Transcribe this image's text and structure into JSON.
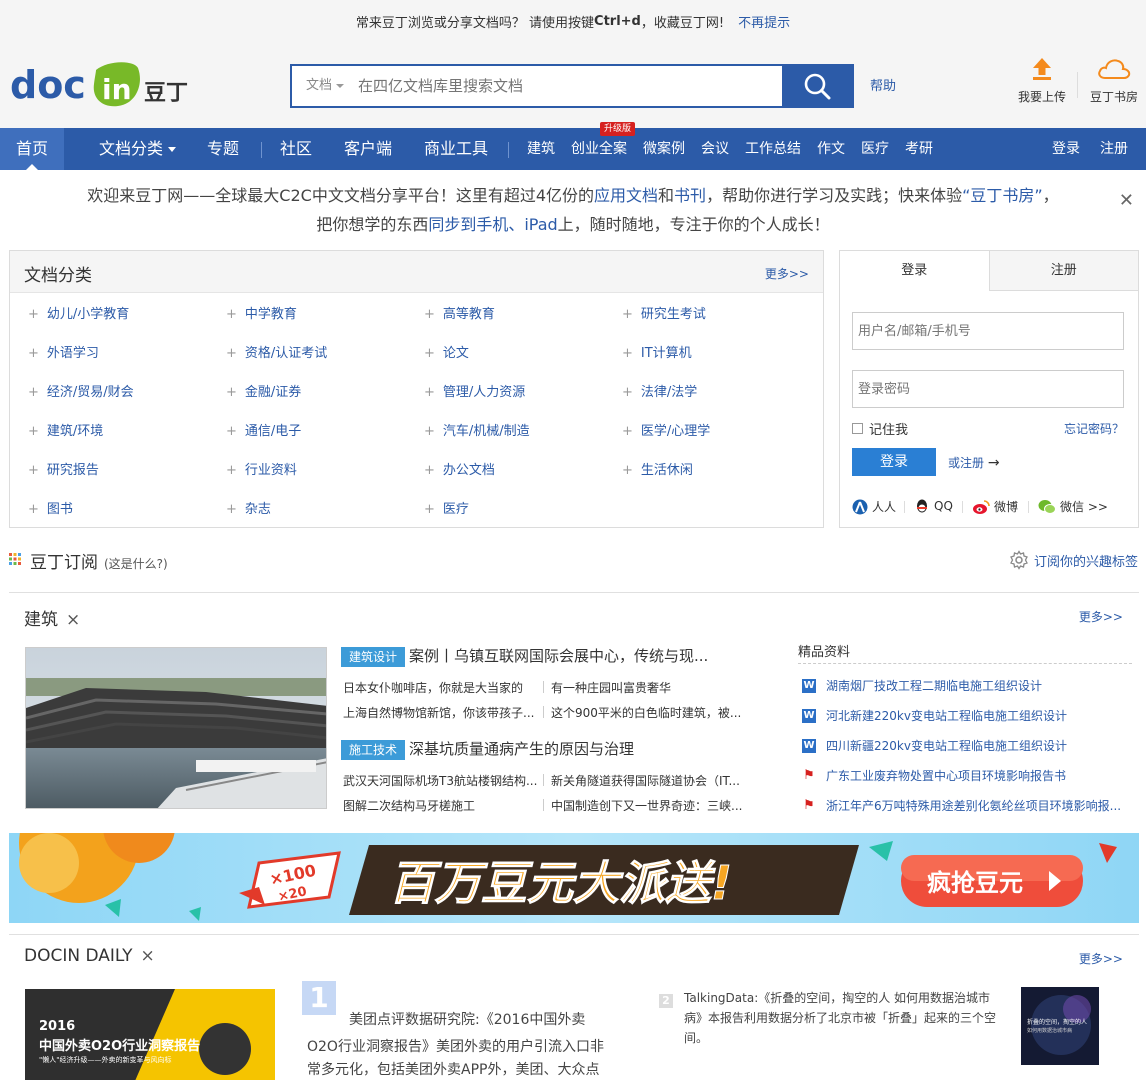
{
  "notice": {
    "text_before": "常来豆丁浏览或分享文档吗？ 请使用按键",
    "shortcut": "Ctrl+d",
    "text_after": "，收藏豆丁网!",
    "dismiss": "不再提示"
  },
  "header": {
    "logo_text": "docin",
    "logo_cn": "豆丁",
    "search_type": "文档",
    "search_placeholder": "在四亿文档库里搜索文档",
    "help": "帮助",
    "upload": "我要上传",
    "bookroom": "豆丁书房"
  },
  "nav": {
    "home": "首页",
    "categories": "文档分类",
    "topics": "专题",
    "community": "社区",
    "client": "客户端",
    "biz_tools": "商业工具",
    "construction": "建筑",
    "startup": "创业全案",
    "upgrade_badge": "升级版",
    "micro_case": "微案例",
    "meeting": "会议",
    "work_summary": "工作总结",
    "essay": "作文",
    "medical": "医疗",
    "exam": "考研",
    "login": "登录",
    "register": "注册"
  },
  "welcome": {
    "l1_a": "欢迎来豆丁网——全球最大C2C中文文档分享平台！这里有超过4亿份的",
    "l1_b": "应用文档",
    "l1_c": "和",
    "l1_d": "书刊",
    "l1_e": "，帮助你进行学习及实践；快来体验",
    "l1_f": "“豆丁书房”",
    "l1_g": "，",
    "l2_a": "把你想学的东西",
    "l2_b": "同步到手机、iPad",
    "l2_c": "上，随时随地，专注于你的个人成长！"
  },
  "categories": {
    "title": "文档分类",
    "more": "更多>>",
    "items": [
      "幼儿/小学教育",
      "中学教育",
      "高等教育",
      "研究生考试",
      "外语学习",
      "资格/认证考试",
      "论文",
      "IT计算机",
      "经济/贸易/财会",
      "金融/证券",
      "管理/人力资源",
      "法律/法学",
      "建筑/环境",
      "通信/电子",
      "汽车/机械/制造",
      "医学/心理学",
      "研究报告",
      "行业资料",
      "办公文档",
      "生活休闲",
      "图书",
      "杂志",
      "医疗"
    ]
  },
  "login": {
    "tab_login": "登录",
    "tab_register": "注册",
    "username_placeholder": "用户名/邮箱/手机号",
    "password_placeholder": "登录密码",
    "remember": "记住我",
    "forgot": "忘记密码？",
    "login_btn": "登录",
    "or_register": "或注册",
    "renren": "人人",
    "qq": "QQ",
    "weibo": "微博",
    "weixin": "微信 >>"
  },
  "subscribe": {
    "title": "豆丁订阅",
    "what": "(这是什么?)",
    "right": "订阅你的兴趣标签"
  },
  "arch": {
    "title": "建筑",
    "close": "×",
    "more": "更多>>",
    "tag1": "建筑设计",
    "headline1": "案例丨乌镇互联网国际会展中心，传统与现...",
    "links1": [
      "日本女仆咖啡店，你就是大当家的",
      "有一种庄园叫富贵奢华",
      "上海自然博物馆新馆，你该带孩子...",
      "这个900平米的白色临时建筑，被..."
    ],
    "tag2": "施工技术",
    "headline2": "深基坑质量通病产生的原因与治理",
    "links2": [
      "武汉天河国际机场T3航站楼钢结构...",
      "新关角隧道获得国际隧道协会（IT...",
      "图解二次结构马牙槎施工",
      "中国制造创下又一世界奇迹：三峡..."
    ],
    "featured_title": "精品资料",
    "docs": [
      {
        "type": "W",
        "title": "湖南烟厂技改工程二期临电施工组织设计"
      },
      {
        "type": "W",
        "title": "河北新建220kv变电站工程临电施工组织设计"
      },
      {
        "type": "W",
        "title": "四川新疆220kv变电站工程临电施工组织设计"
      },
      {
        "type": "P",
        "title": "广东工业废弃物处置中心项目环境影响报告书"
      },
      {
        "type": "P",
        "title": "浙江年产6万吨特殊用途差别化氨纶丝项目环境影响报..."
      }
    ]
  },
  "banner": {
    "slogan": "百万豆元大派送!",
    "cta": "疯抢豆元",
    "coupon": "×100",
    "coupon2": "×20"
  },
  "daily": {
    "title": "DOCIN DAILY",
    "close": "×",
    "more": "更多>>",
    "img_year": "2016",
    "img_title": "中国外卖O2O行业洞察报告",
    "img_sub": "\"懒人\"经济升级——外卖的新变革与风向标",
    "num1": "1",
    "text1_l1": "美团点评数据研究院:《2016中国外卖",
    "text1_l2": "O2O行业洞察报告》美团外卖的用户引流入口非",
    "text1_l3": "常多元化，包括美团外卖APP外，美团、大众点",
    "num2": "2",
    "text2_l1": "TalkingData:《折叠的空间，掏空的人 如何用数据治城市",
    "text2_l2": "病》本报告利用数据分析了北京市被「折叠」起来的三个空",
    "text2_l3": "间。",
    "thumb_l1": "折叠的空间，掏空的人",
    "thumb_l2": "如何用数据治城市病"
  },
  "colors": {
    "primary": "#2c5ba8",
    "logo_green": "#78b928",
    "tag_blue": "#3c9bd8",
    "login_btn": "#2a7fd4",
    "badge_red": "#d6211f"
  }
}
